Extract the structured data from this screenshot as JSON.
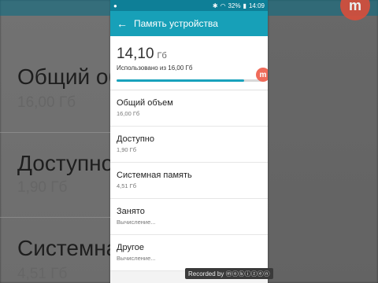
{
  "status_bar": {
    "battery": "32%",
    "time": "14:09"
  },
  "app_bar": {
    "title": "Память устройства"
  },
  "storage": {
    "used_value": "14,10",
    "used_unit": "Гб",
    "used_caption": "Использовано из 16,00 Гб",
    "used_fraction": 0.881,
    "logo_glyph": "m"
  },
  "items": [
    {
      "title": "Общий объем",
      "value": "16,00 Гб"
    },
    {
      "title": "Доступно",
      "value": "1,90 Гб"
    },
    {
      "title": "Системная память",
      "value": "4,51 Гб"
    },
    {
      "title": "Занято",
      "value": "Вычисление..."
    },
    {
      "title": "Другое",
      "value": "Вычисление..."
    }
  ],
  "background_left": [
    {
      "title": "Общий об",
      "value": "16,00 Гб"
    },
    {
      "title": "Доступно",
      "value": "1,90 Гб"
    },
    {
      "title": "Системна",
      "value": "4,51 Гб"
    }
  ],
  "background_right": {
    "logo_glyph": "m"
  },
  "watermark": {
    "text": "Recorded by ⓜⓞⓑⓘⓩⓔⓝ"
  },
  "colors": {
    "accent": "#17A0B8",
    "status_bar": "#0E7F97",
    "badge": "#F06B5A"
  }
}
